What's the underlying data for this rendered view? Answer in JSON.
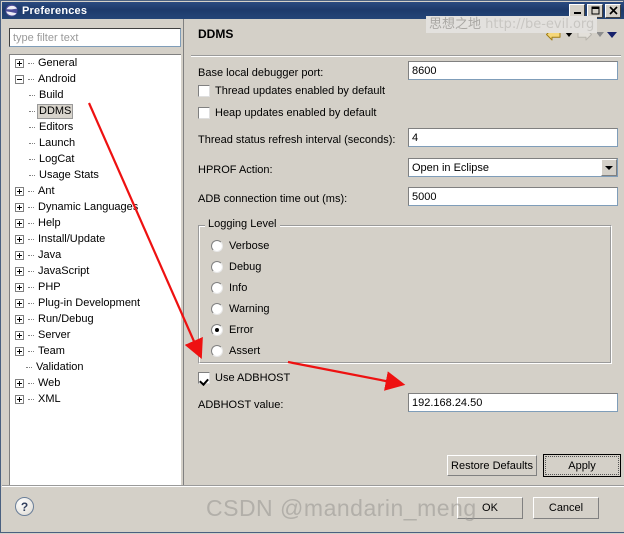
{
  "window": {
    "title": "Preferences",
    "icon": "eclipse-icon",
    "buttons": {
      "minimize": "_",
      "maximize": "❐",
      "close": "✕"
    }
  },
  "sidebar": {
    "filter": {
      "placeholder": "type filter text",
      "value": ""
    },
    "tree": [
      {
        "label": "General",
        "state": "collapsed",
        "level": 0
      },
      {
        "label": "Android",
        "state": "expanded",
        "level": 0
      },
      {
        "label": "Build",
        "state": "leaf",
        "level": 1
      },
      {
        "label": "DDMS",
        "state": "leaf",
        "level": 1,
        "selected": true
      },
      {
        "label": "Editors",
        "state": "leaf",
        "level": 1
      },
      {
        "label": "Launch",
        "state": "leaf",
        "level": 1
      },
      {
        "label": "LogCat",
        "state": "leaf",
        "level": 1
      },
      {
        "label": "Usage Stats",
        "state": "leaf",
        "level": 1
      },
      {
        "label": "Ant",
        "state": "collapsed",
        "level": 0
      },
      {
        "label": "Dynamic Languages",
        "state": "collapsed",
        "level": 0
      },
      {
        "label": "Help",
        "state": "collapsed",
        "level": 0
      },
      {
        "label": "Install/Update",
        "state": "collapsed",
        "level": 0
      },
      {
        "label": "Java",
        "state": "collapsed",
        "level": 0
      },
      {
        "label": "JavaScript",
        "state": "collapsed",
        "level": 0
      },
      {
        "label": "PHP",
        "state": "collapsed",
        "level": 0
      },
      {
        "label": "Plug-in Development",
        "state": "collapsed",
        "level": 0
      },
      {
        "label": "Run/Debug",
        "state": "collapsed",
        "level": 0
      },
      {
        "label": "Server",
        "state": "collapsed",
        "level": 0
      },
      {
        "label": "Team",
        "state": "collapsed",
        "level": 0
      },
      {
        "label": "Validation",
        "state": "leaf-root",
        "level": 0
      },
      {
        "label": "Web",
        "state": "collapsed",
        "level": 0
      },
      {
        "label": "XML",
        "state": "collapsed",
        "level": 0
      }
    ]
  },
  "panel": {
    "title": "DDMS",
    "nav": {
      "back": "back-arrow",
      "back_menu": "dropdown-caret",
      "forward": "forward-arrow",
      "forward_menu": "dropdown-caret",
      "menu": "view-menu-caret"
    },
    "fields": {
      "base_port_label": "Base local debugger port:",
      "base_port_value": "8600",
      "thread_updates_label": "Thread updates enabled by default",
      "thread_updates_checked": false,
      "heap_updates_label": "Heap updates enabled by default",
      "heap_updates_checked": false,
      "refresh_label": "Thread status refresh interval (seconds):",
      "refresh_value": "4",
      "hprof_label": "HPROF Action:",
      "hprof_value": "Open in Eclipse",
      "adb_timeout_label": "ADB connection time out (ms):",
      "adb_timeout_value": "5000",
      "use_adbhost_label": "Use ADBHOST",
      "use_adbhost_checked": true,
      "adbhost_value_label": "ADBHOST value:",
      "adbhost_value": "192.168.24.50"
    },
    "logging": {
      "group_label": "Logging Level",
      "options": [
        "Verbose",
        "Debug",
        "Info",
        "Warning",
        "Error",
        "Assert"
      ],
      "selected": "Error"
    },
    "buttons": {
      "restore_defaults": "Restore Defaults",
      "restore_defaults_mnemonic": "D",
      "apply": "Apply",
      "apply_mnemonic": "A"
    }
  },
  "footer": {
    "help_icon": "?",
    "ok": "OK",
    "cancel": "Cancel"
  },
  "watermarks": {
    "top_cn": "思想之地",
    "top_url": "http://be-evil.org",
    "bottom": "CSDN @mandarin_meng"
  },
  "annotations": {
    "accent_color": "#ee1111",
    "arrow1": "arrow-ddms-to-use-adbhost",
    "arrow2": "arrow-use-adbhost-to-value-field"
  }
}
